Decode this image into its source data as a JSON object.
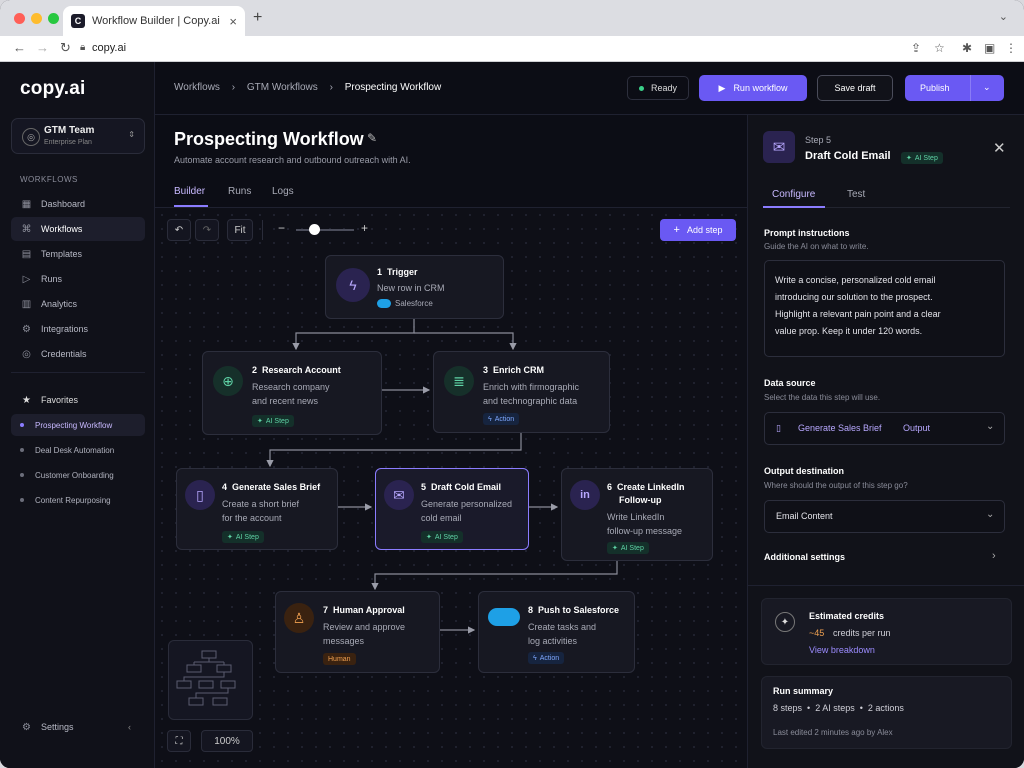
{
  "browser": {
    "tab_title": "Workflow Builder | Copy.ai",
    "favicon": "C",
    "url": "copy.ai"
  },
  "sidebar": {
    "logo": "copy.ai",
    "team_name": "GTM Team",
    "team_plan": "Enterprise Plan",
    "section_workflows": "WORKFLOWS",
    "items": [
      {
        "icon": "▦",
        "label": "Dashboard"
      },
      {
        "icon": "⌘",
        "label": "Workflows"
      },
      {
        "icon": "▤",
        "label": "Templates"
      },
      {
        "icon": "▷",
        "label": "Runs"
      },
      {
        "icon": "▥",
        "label": "Analytics"
      },
      {
        "icon": "⚙",
        "label": "Integrations"
      },
      {
        "icon": "◎",
        "label": "Credentials"
      }
    ],
    "favorites_label": "Favorites",
    "favorites": [
      "Prospecting Workflow",
      "Deal Desk Automation",
      "Customer Onboarding",
      "Content Repurposing"
    ],
    "settings": "Settings"
  },
  "header": {
    "crumb1": "Workflows",
    "crumb2": "GTM Workflows",
    "crumb3": "Prospecting Workflow",
    "status": "Ready",
    "run": "Run workflow",
    "save": "Save draft",
    "publish": "Publish"
  },
  "page": {
    "title": "Prospecting Workflow",
    "subtitle": "Automate account research and outbound outreach with AI.",
    "tabs": [
      "Builder",
      "Runs",
      "Logs"
    ]
  },
  "toolbar": {
    "fit": "Fit",
    "add_step": "Add step",
    "zoom": "100%"
  },
  "nodes": [
    {
      "num": "1",
      "title": "Trigger",
      "desc": "New row in CRM",
      "app": "Salesforce"
    },
    {
      "num": "2",
      "title": "Research Account",
      "desc1": "Research company",
      "desc2": "and recent news",
      "badge": "AI Step"
    },
    {
      "num": "3",
      "title": "Enrich CRM",
      "desc1": "Enrich with firmographic",
      "desc2": "and technographic data",
      "badge": "Action"
    },
    {
      "num": "4",
      "title": "Generate Sales Brief",
      "desc1": "Create a short brief",
      "desc2": "for the account",
      "badge": "AI Step"
    },
    {
      "num": "5",
      "title": "Draft Cold Email",
      "desc1": "Generate personalized",
      "desc2": "cold email",
      "badge": "AI Step"
    },
    {
      "num": "6",
      "title": "Create LinkedIn",
      "title2": "Follow-up",
      "desc1": "Write LinkedIn",
      "desc2": "follow-up message",
      "badge": "AI Step"
    },
    {
      "num": "7",
      "title": "Human Approval",
      "desc1": "Review and approve",
      "desc2": "messages",
      "badge": "Human"
    },
    {
      "num": "8",
      "title": "Push to Salesforce",
      "desc1": "Create tasks and",
      "desc2": "log activities",
      "badge": "Action"
    }
  ],
  "panel": {
    "step": "Step 5",
    "title": "Draft Cold Email",
    "badge": "AI Step",
    "tabs": [
      "Configure",
      "Test"
    ],
    "prompt_label": "Prompt instructions",
    "prompt_hint": "Guide the AI on what to write.",
    "prompt_lines": [
      "Write a concise, personalized cold email",
      "introducing our solution to the prospect.",
      "Highlight a relevant pain point and a clear",
      "value prop. Keep it under 120 words."
    ],
    "source_label": "Data source",
    "source_hint": "Select the data this step will use.",
    "source_value": "Generate Sales Brief",
    "source_tag": "Output",
    "dest_label": "Output destination",
    "dest_hint": "Where should the output of this step go?",
    "dest_value": "Email Content",
    "additional": "Additional settings",
    "credits_label": "Estimated credits",
    "credits_value": "~45",
    "credits_unit": "credits per run",
    "credits_link": "View breakdown",
    "summary_label": "Run summary",
    "summary_steps": "8 steps",
    "summary_ai": "2 AI steps",
    "summary_actions": "2 actions",
    "summary_edited": "Last edited 2 minutes ago by Alex"
  },
  "colors": {
    "accent": "#6a59f3",
    "ai": "#5fd3a6",
    "action": "#7fa8ff",
    "human": "#f0a050"
  }
}
